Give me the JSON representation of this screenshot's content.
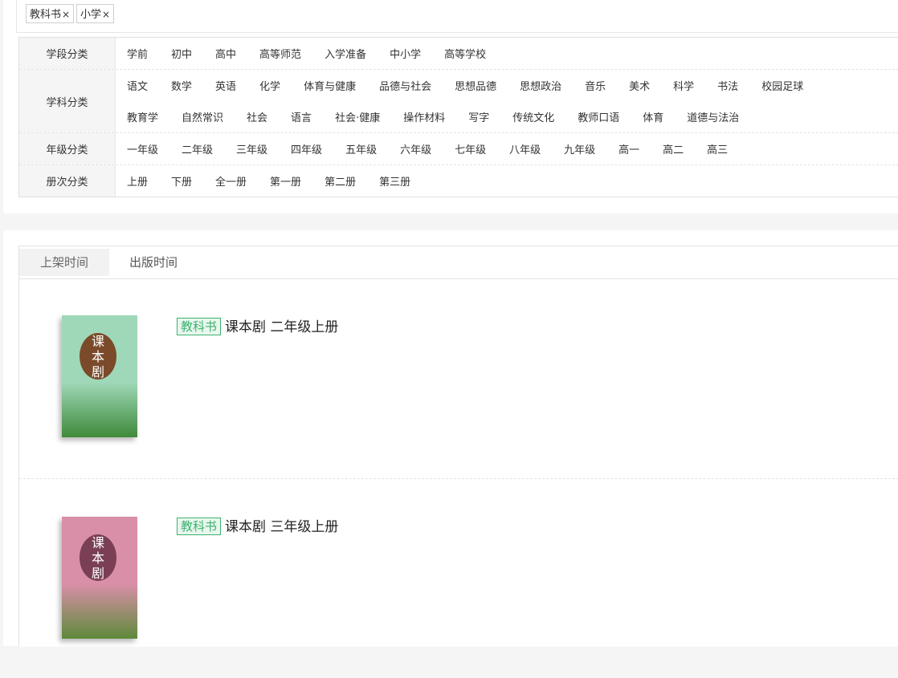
{
  "selected_filters": [
    {
      "label": "教科书",
      "remove": "×"
    },
    {
      "label": "小学",
      "remove": "×"
    }
  ],
  "filters": {
    "stage": {
      "title": "学段分类",
      "options": [
        "学前",
        "初中",
        "高中",
        "高等师范",
        "入学准备",
        "中小学",
        "高等学校"
      ]
    },
    "subject": {
      "title": "学科分类",
      "options_line1": [
        "语文",
        "数学",
        "英语",
        "化学",
        "体育与健康",
        "品德与社会",
        "思想品德",
        "思想政治",
        "音乐",
        "美术",
        "科学",
        "书法",
        "校园足球"
      ],
      "options_line2": [
        "教育学",
        "自然常识",
        "社会",
        "语言",
        "社会·健康",
        "操作材料",
        "写字",
        "传统文化",
        "教师口语",
        "体育",
        "道德与法治"
      ]
    },
    "grade": {
      "title": "年级分类",
      "options": [
        "一年级",
        "二年级",
        "三年级",
        "四年级",
        "五年级",
        "六年级",
        "七年级",
        "八年级",
        "九年级",
        "高一",
        "高二",
        "高三"
      ]
    },
    "volume": {
      "title": "册次分类",
      "options": [
        "上册",
        "下册",
        "全一册",
        "第一册",
        "第二册",
        "第三册"
      ]
    }
  },
  "sort_tabs": [
    {
      "label": "上架时间",
      "active": true
    },
    {
      "label": "出版时间",
      "active": false
    }
  ],
  "books": [
    {
      "badge": "教科书",
      "title": "课本剧 二年级上册",
      "cover_text": [
        "课",
        "本",
        "剧"
      ],
      "cover_colors": {
        "top": "#9fd8b8",
        "circle": "#7a4a2a",
        "bottom": "#3f8a3a"
      }
    },
    {
      "badge": "教科书",
      "title": "课本剧 三年级上册",
      "cover_text": [
        "课",
        "本",
        "剧"
      ],
      "cover_colors": {
        "top": "#d98fa8",
        "circle": "#7a3f55",
        "bottom": "#5e8a3a"
      }
    }
  ],
  "colors": {
    "accent_green": "#3db36d"
  }
}
